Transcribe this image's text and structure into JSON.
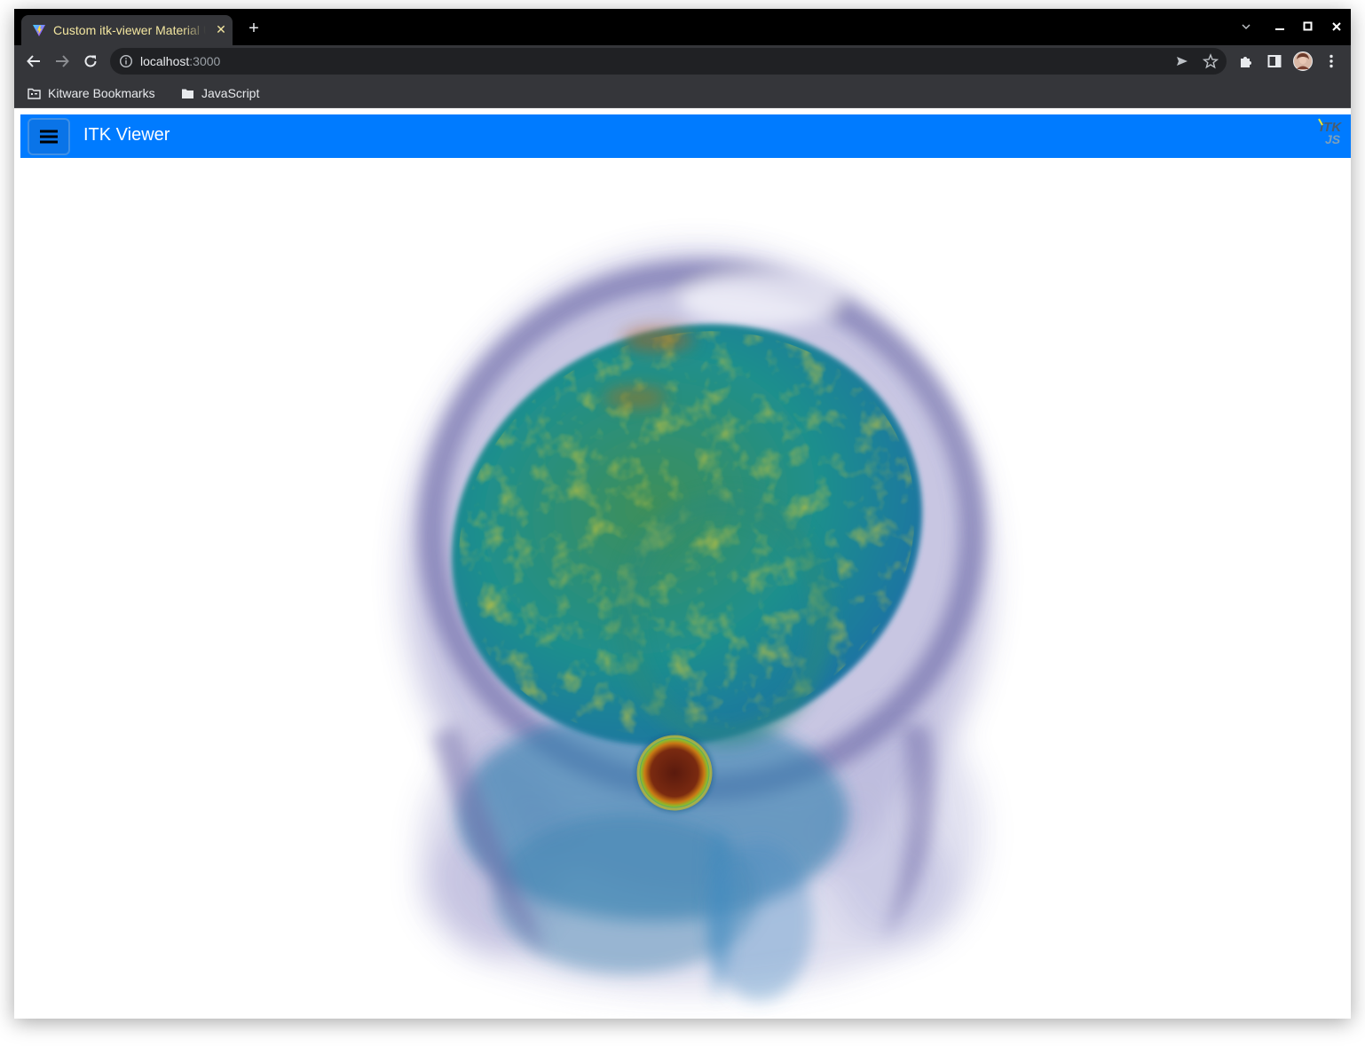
{
  "browser": {
    "tab": {
      "title": "Custom itk-viewer Material UI",
      "close_icon": "close-icon",
      "favicon": "vite-favicon-icon"
    },
    "new_tab_icon": "plus-icon",
    "window_controls": {
      "tab_search_icon": "chevron-down-icon",
      "minimize_icon": "minimize-icon",
      "maximize_icon": "maximize-icon",
      "close_icon": "close-icon"
    },
    "address": {
      "host": "localhost",
      "port": ":3000"
    },
    "bookmarks": [
      {
        "label": "Kitware Bookmarks",
        "icon": "folder-icon"
      },
      {
        "label": "JavaScript",
        "icon": "folder-icon"
      }
    ]
  },
  "app": {
    "title": "ITK Viewer",
    "menu_icon": "hamburger-menu-icon",
    "logo_icon": "itk-js-logo-icon",
    "accent_color": "#007bff"
  },
  "viewport": {
    "content": "volume-rendering-3d"
  }
}
